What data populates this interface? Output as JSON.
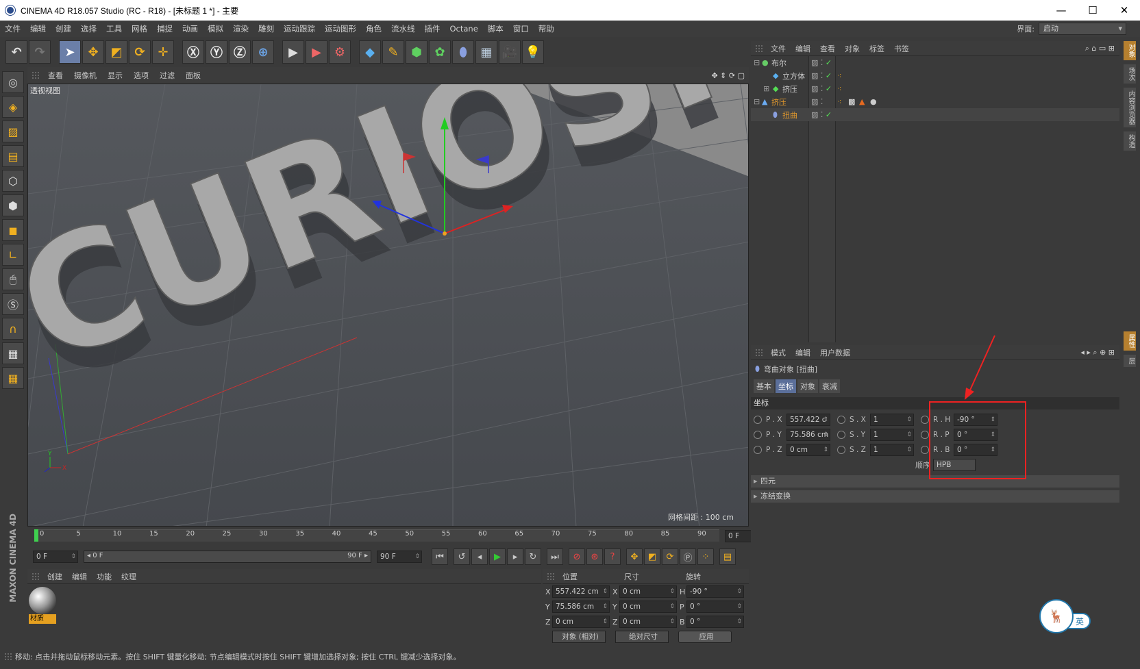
{
  "window": {
    "title": "CINEMA 4D R18.057 Studio (RC - R18) - [未标题 1 *] - 主要"
  },
  "menu": [
    "文件",
    "编辑",
    "创建",
    "选择",
    "工具",
    "网格",
    "捕捉",
    "动画",
    "模拟",
    "渲染",
    "雕刻",
    "运动跟踪",
    "运动图形",
    "角色",
    "流水线",
    "插件",
    "Octane",
    "脚本",
    "窗口",
    "帮助"
  ],
  "layout": {
    "label": "界面:",
    "value": "启动"
  },
  "viewport": {
    "menu": [
      "查看",
      "摄像机",
      "显示",
      "选项",
      "过滤",
      "面板"
    ],
    "label": "透视视图",
    "grid_info": "网格间距 : 100 cm",
    "text3d": "CURIOSITY"
  },
  "timeline": {
    "ticks": [
      "0",
      "5",
      "10",
      "15",
      "20",
      "25",
      "30",
      "35",
      "40",
      "45",
      "50",
      "55",
      "60",
      "65",
      "70",
      "75",
      "80",
      "85",
      "90"
    ],
    "current": "0 F"
  },
  "transport": {
    "start": "0 F",
    "range_start": "0 F",
    "range_end": "90 F",
    "end": "90 F"
  },
  "material": {
    "menu": [
      "创建",
      "编辑",
      "功能",
      "纹理"
    ],
    "item": "材质"
  },
  "coords": {
    "headers": [
      "位置",
      "尺寸",
      "旋转"
    ],
    "rows": [
      {
        "a": "X",
        "pos": "557.422 cm",
        "b": "X",
        "size": "0 cm",
        "c": "H",
        "rot": "-90 °"
      },
      {
        "a": "Y",
        "pos": "75.586 cm",
        "b": "Y",
        "size": "0 cm",
        "c": "P",
        "rot": "0 °"
      },
      {
        "a": "Z",
        "pos": "0 cm",
        "b": "Z",
        "size": "0 cm",
        "c": "B",
        "rot": "0 °"
      }
    ],
    "mode": "对象 (相对)",
    "size_mode": "绝对尺寸",
    "apply": "应用"
  },
  "status": "移动: 点击并拖动鼠标移动元素。按住 SHIFT 键量化移动; 节点编辑模式时按住 SHIFT 键增加选择对象; 按住 CTRL 键减少选择对象。",
  "objects": {
    "menu": [
      "文件",
      "编辑",
      "查看",
      "对象",
      "标签",
      "书签"
    ],
    "items": [
      {
        "name": "布尔",
        "level": 0,
        "color": "#c8c8c8"
      },
      {
        "name": "立方体",
        "level": 1,
        "color": "#c8c8c8"
      },
      {
        "name": "挤压",
        "level": 1,
        "color": "#c8c8c8"
      },
      {
        "name": "挤压",
        "level": 0,
        "color": "#e59a2c"
      },
      {
        "name": "扭曲",
        "level": 1,
        "color": "#e59a2c"
      }
    ]
  },
  "attributes": {
    "menu": [
      "模式",
      "编辑",
      "用户数据"
    ],
    "title": "弯曲对象 [扭曲]",
    "tabs": [
      "基本",
      "坐标",
      "对象",
      "衰减"
    ],
    "active_tab": "坐标",
    "section": "坐标",
    "rows": [
      {
        "p": "P . X",
        "pv": "557.422 c",
        "s": "S . X",
        "sv": "1",
        "r": "R . H",
        "rv": "-90 °"
      },
      {
        "p": "P . Y",
        "pv": "75.586 cm",
        "s": "S . Y",
        "sv": "1",
        "r": "R . P",
        "rv": "0 °"
      },
      {
        "p": "P . Z",
        "pv": "0 cm",
        "s": "S . Z",
        "sv": "1",
        "r": "R . B",
        "rv": "0 °"
      }
    ],
    "order_label": "顺序",
    "order_value": "HPB",
    "groups": [
      "四元",
      "冻结变换"
    ]
  },
  "side_tabs": [
    "对象",
    "场次",
    "内容浏览器",
    "构造"
  ],
  "side_tabs2": [
    "属性",
    "层"
  ],
  "brand": "MAXON CINEMA 4D",
  "ime": "英",
  "colors": {
    "accent": "#5b6f9a",
    "highlight": "#e59a2c",
    "annotation": "#ee2222"
  }
}
